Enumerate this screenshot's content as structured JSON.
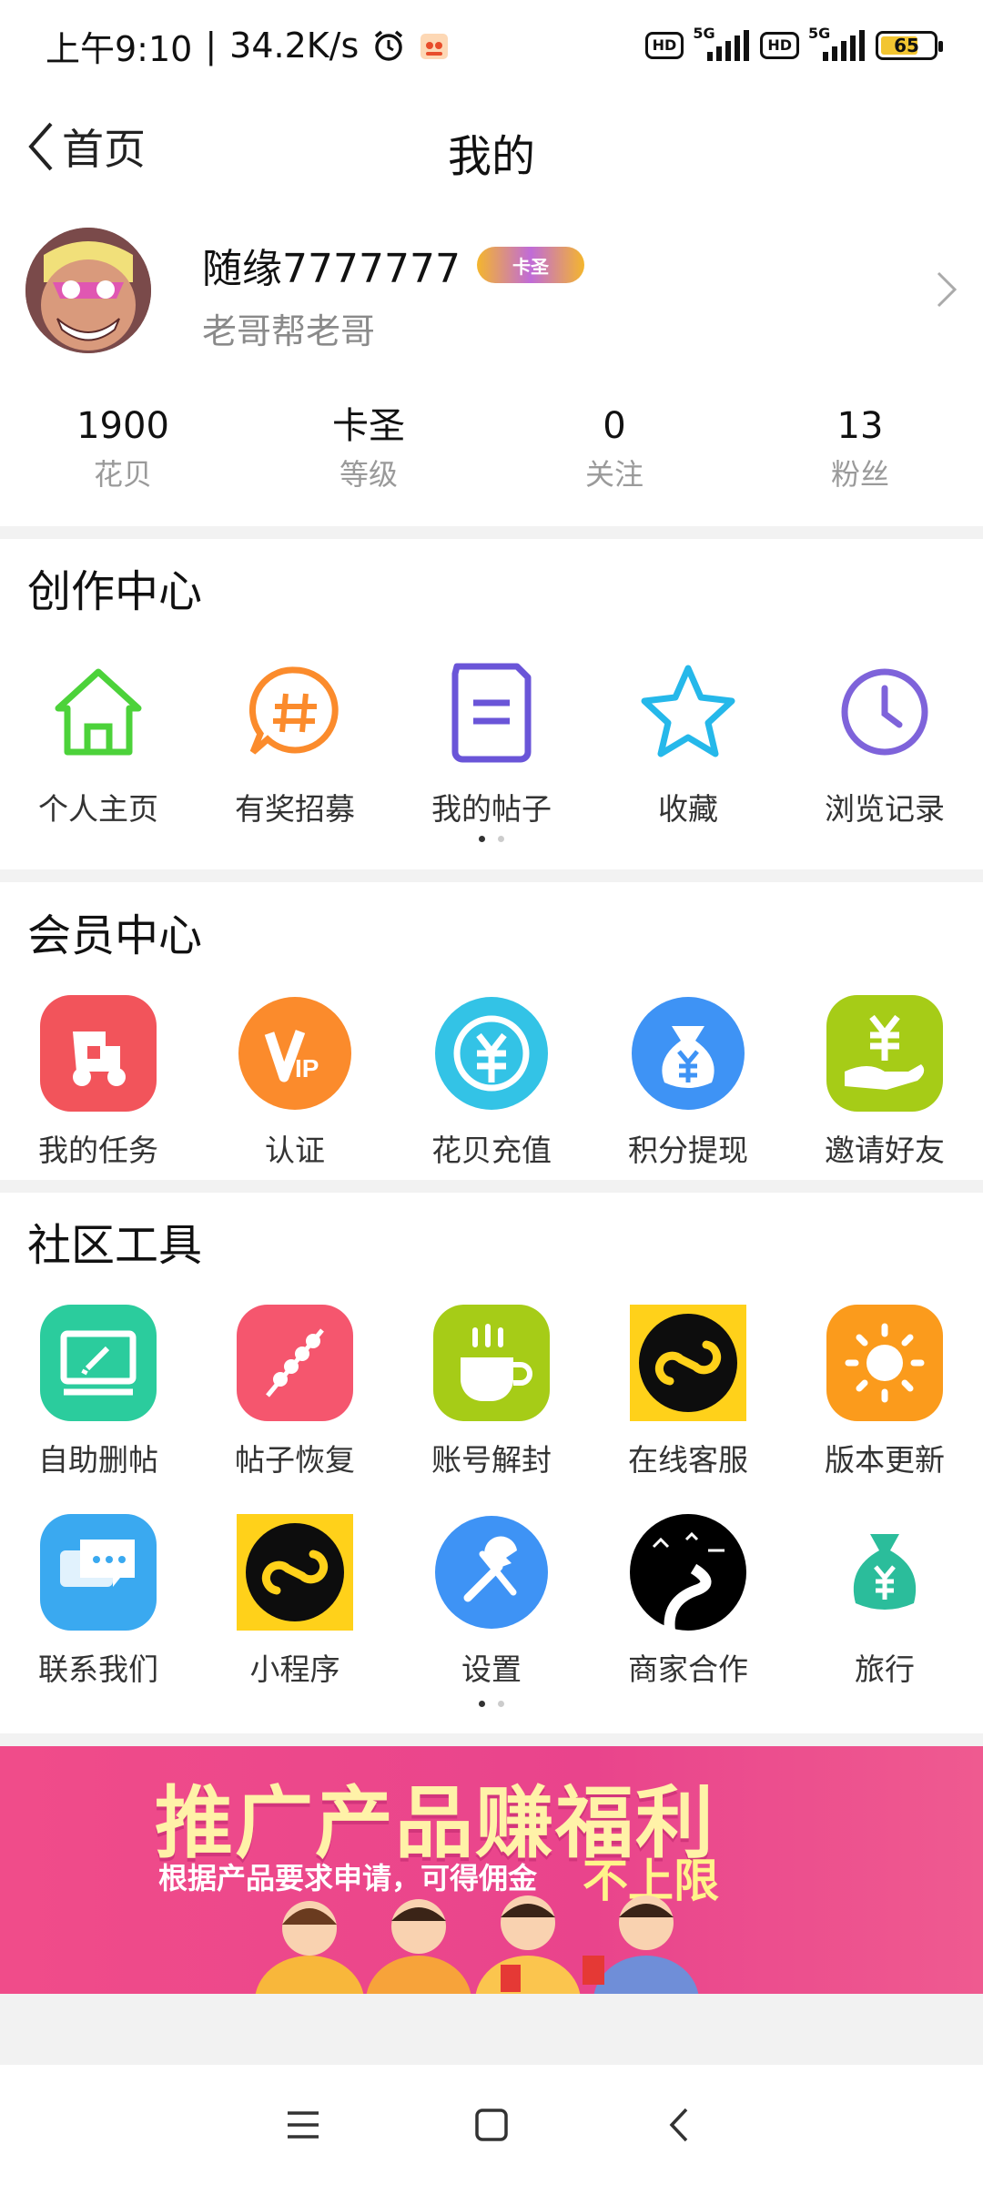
{
  "status_bar": {
    "time": "上午9:10",
    "net_speed": "34.2K/s",
    "hd1": "HD",
    "hd2": "HD",
    "net1": "5G",
    "net2": "5G",
    "battery": "65"
  },
  "nav": {
    "back_label": "首页",
    "title": "我的"
  },
  "profile": {
    "username": "随缘7777777",
    "badge": "卡圣",
    "signature": "老哥帮老哥"
  },
  "stats": [
    {
      "value": "1900",
      "label": "花贝"
    },
    {
      "value": "卡圣",
      "label": "等级"
    },
    {
      "value": "0",
      "label": "关注"
    },
    {
      "value": "13",
      "label": "粉丝"
    }
  ],
  "creation_center": {
    "title": "创作中心",
    "items": [
      {
        "label": "个人主页",
        "icon": "home-icon"
      },
      {
        "label": "有奖招募",
        "icon": "hashtag-icon"
      },
      {
        "label": "我的帖子",
        "icon": "post-icon"
      },
      {
        "label": "收藏",
        "icon": "star-icon"
      },
      {
        "label": "浏览记录",
        "icon": "clock-icon"
      }
    ]
  },
  "member_center": {
    "title": "会员中心",
    "items": [
      {
        "label": "我的任务",
        "icon": "task-icon",
        "color": "#f2545b"
      },
      {
        "label": "认证",
        "icon": "vip-icon",
        "color": "#fb8b2c"
      },
      {
        "label": "花贝充值",
        "icon": "recharge-icon",
        "color": "#33c3e6"
      },
      {
        "label": "积分提现",
        "icon": "money-bag-icon",
        "color": "#3e93f5"
      },
      {
        "label": "邀请好友",
        "icon": "invite-icon",
        "color": "#a6cc17"
      }
    ]
  },
  "community_tools": {
    "title": "社区工具",
    "row1": [
      {
        "label": "自助删帖",
        "icon": "delete-post-icon",
        "color": "#2bcc9d"
      },
      {
        "label": "帖子恢复",
        "icon": "restore-post-icon",
        "color": "#f5566e"
      },
      {
        "label": "账号解封",
        "icon": "unblock-icon",
        "color": "#a6cc17"
      },
      {
        "label": "在线客服",
        "icon": "mini-program-icon",
        "color": "#ffd11a"
      },
      {
        "label": "版本更新",
        "icon": "sun-icon",
        "color": "#fb9b1c"
      }
    ],
    "row2": [
      {
        "label": "联系我们",
        "icon": "chat-icon",
        "color": "#3aa9f0"
      },
      {
        "label": "小程序",
        "icon": "mini-program-icon",
        "color": "#ffd11a"
      },
      {
        "label": "设置",
        "icon": "settings-icon",
        "color": "#3e93f5"
      },
      {
        "label": "商家合作",
        "icon": "road-icon",
        "color": "#000000"
      },
      {
        "label": "旅行",
        "icon": "money-bag-icon",
        "color": "#2bbd9b"
      }
    ]
  },
  "banner": {
    "title": "推广产品赚福利",
    "subtitle": "根据产品要求申请，可得佣金",
    "highlight": "不上限"
  }
}
